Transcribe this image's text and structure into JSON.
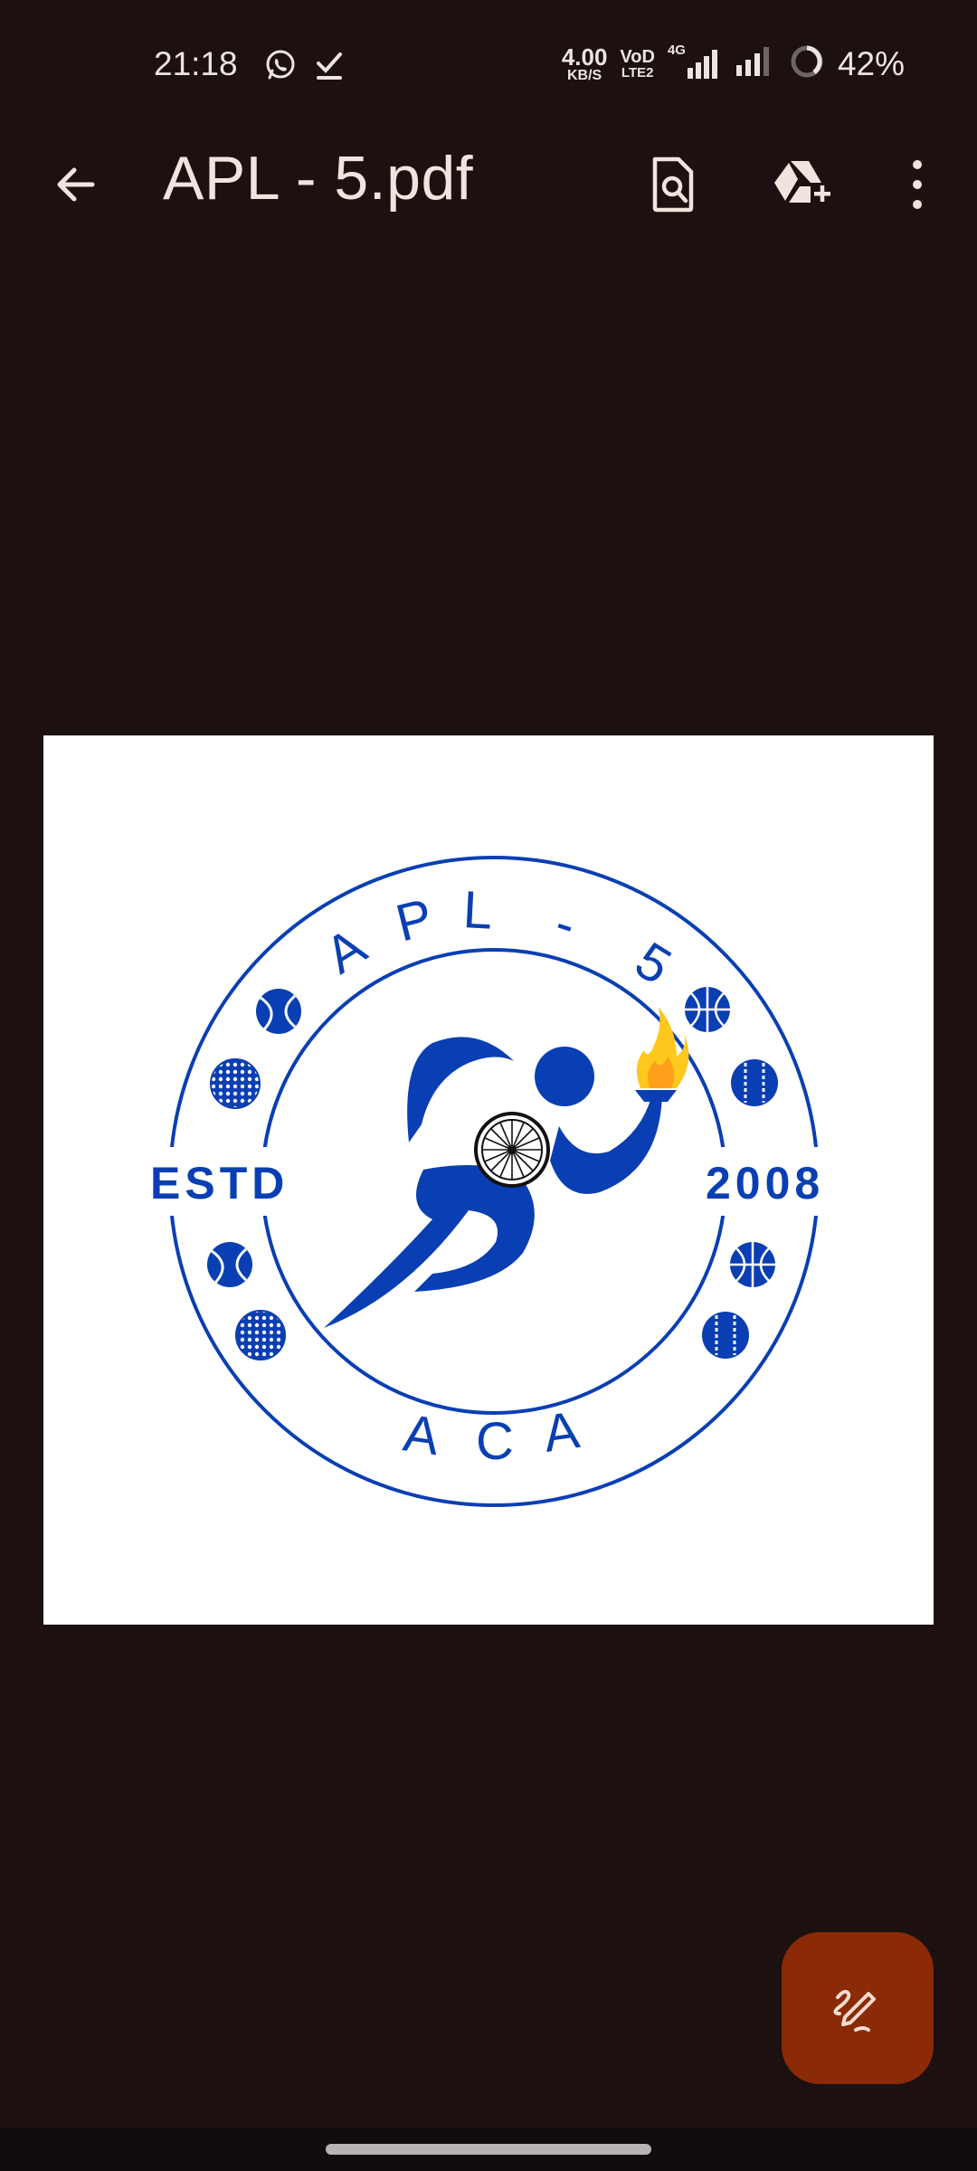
{
  "status_bar": {
    "time": "21:18",
    "left_icons": [
      "whatsapp-icon",
      "checkmark-icon"
    ],
    "net_speed_value": "4.00",
    "net_speed_unit": "KB/S",
    "volte_top": "VoD",
    "volte_bottom": "LTE2",
    "network": "4G",
    "battery_percent": "42%"
  },
  "toolbar": {
    "title": "APL - 5.pdf",
    "icons": [
      "back-arrow-icon",
      "search-document-icon",
      "drive-add-icon",
      "more-vert-icon"
    ]
  },
  "document": {
    "logo": {
      "top_text": [
        "A",
        "P",
        "L",
        "-",
        "5"
      ],
      "left_text": "ESTD",
      "right_text": "2008",
      "bottom_text": [
        "A",
        "C",
        "A"
      ]
    }
  },
  "fab": {
    "icon": "annotate-pen-icon"
  },
  "colors": {
    "background": "#1c1010",
    "accent": "#8a2a06",
    "logo_blue": "#0a3fb3",
    "title_text": "#f2e3de"
  }
}
